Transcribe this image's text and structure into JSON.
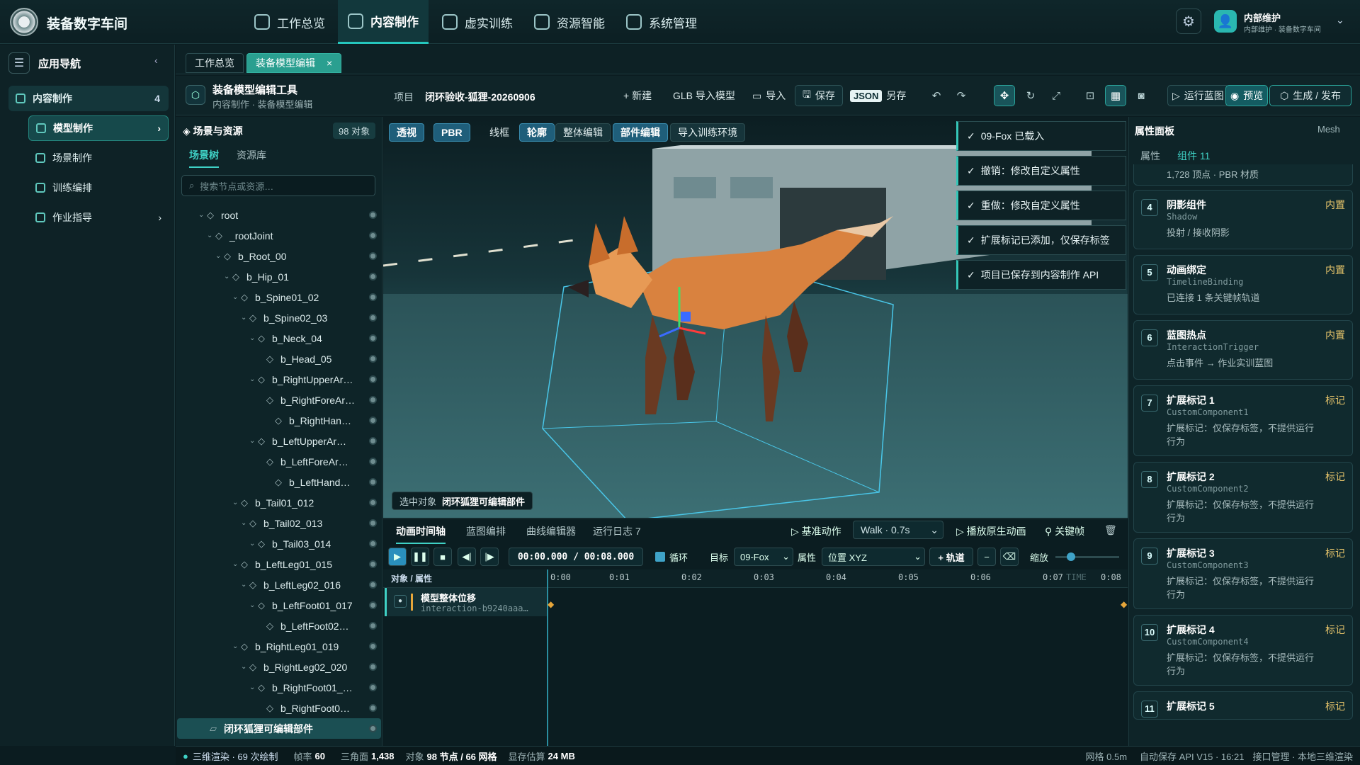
{
  "app": {
    "title": "装备数字车间"
  },
  "topnav": [
    "工作总览",
    "内容制作",
    "虚实训练",
    "资源智能",
    "系统管理"
  ],
  "user": {
    "name": "内部维护",
    "sub": "内部维护 · 装备数字车间"
  },
  "sidebar": {
    "header": "应用导航",
    "section": "内容制作",
    "section_count": "4",
    "items": [
      "模型制作",
      "场景制作",
      "训练编排",
      "作业指导"
    ]
  },
  "file_tabs": [
    "工作总览",
    "装备模型编辑"
  ],
  "toolbar": {
    "title": "装备模型编辑工具",
    "breadcrumb": "内容制作 · 装备模型编辑",
    "project_label": "项目",
    "project_value": "闭环验收-狐狸-20260906",
    "new": "+ 新建",
    "import_model": "GLB 导入模型",
    "import": "导入",
    "save": "保存",
    "json": "JSON",
    "save_as": "另存",
    "run_blueprint": "运行蓝图",
    "preview": "预览",
    "publish": "生成 / 发布"
  },
  "left": {
    "title": "场景与资源",
    "count": "98 对象",
    "tabs": [
      "场景树",
      "资源库"
    ],
    "search_placeholder": "搜索节点或资源…",
    "tree": [
      {
        "n": "root",
        "d": 0
      },
      {
        "n": "_rootJoint",
        "d": 1
      },
      {
        "n": "b_Root_00",
        "d": 2
      },
      {
        "n": "b_Hip_01",
        "d": 3
      },
      {
        "n": "b_Spine01_02",
        "d": 4
      },
      {
        "n": "b_Spine02_03",
        "d": 5
      },
      {
        "n": "b_Neck_04",
        "d": 6
      },
      {
        "n": "b_Head_05",
        "d": 7
      },
      {
        "n": "b_RightUpperAr…",
        "d": 6
      },
      {
        "n": "b_RightForeAr…",
        "d": 7
      },
      {
        "n": "b_RightHan…",
        "d": 8
      },
      {
        "n": "b_LeftUpperAr…",
        "d": 6
      },
      {
        "n": "b_LeftForeAr…",
        "d": 7
      },
      {
        "n": "b_LeftHand…",
        "d": 8
      },
      {
        "n": "b_Tail01_012",
        "d": 4
      },
      {
        "n": "b_Tail02_013",
        "d": 5
      },
      {
        "n": "b_Tail03_014",
        "d": 6
      },
      {
        "n": "b_LeftLeg01_015",
        "d": 4
      },
      {
        "n": "b_LeftLeg02_016",
        "d": 5
      },
      {
        "n": "b_LeftFoot01_017",
        "d": 6
      },
      {
        "n": "b_LeftFoot02…",
        "d": 7
      },
      {
        "n": "b_RightLeg01_019",
        "d": 4
      },
      {
        "n": "b_RightLeg02_020",
        "d": 5
      },
      {
        "n": "b_RightFoot01_…",
        "d": 6
      },
      {
        "n": "b_RightFoot0…",
        "d": 7
      },
      {
        "n": "闭环狐狸可编辑部件",
        "d": 3
      }
    ]
  },
  "viewport": {
    "modes": [
      "透视",
      "PBR",
      "线框",
      "轮廓",
      "整体编辑",
      "部件编辑",
      "导入训练环境"
    ],
    "selected_label": "选中对象",
    "selected_value": "闭环狐狸可编辑部件"
  },
  "toasts": [
    "09-Fox 已载入",
    "撤销：修改自定义属性",
    "重做：修改自定义属性",
    "扩展标记已添加，仅保存标签",
    "项目已保存到内容制作 API"
  ],
  "timeline": {
    "tabs": [
      "动画时间轴",
      "蓝图编排",
      "曲线编辑器",
      "运行日志 7"
    ],
    "base_action": "基准动作",
    "clip": "Walk · 0.7s",
    "play_original": "播放原生动画",
    "keyframe": "关键帧",
    "time": "00:00.000 / 00:08.000",
    "loop": "循环",
    "target_label": "目标",
    "target": "09-Fox",
    "prop_label": "属性",
    "prop": "位置 XYZ",
    "add_track": "+ 轨道",
    "zoom": "缩放",
    "col_header": "对象 / 属性",
    "ticks": [
      "0:00",
      "0:01",
      "0:02",
      "0:03",
      "0:04",
      "0:05",
      "0:06",
      "0:07",
      "0:08"
    ],
    "time_watermark": "TIME",
    "track_name": "模型整体位移",
    "track_id": "interaction-b9240aaa…"
  },
  "right": {
    "title": "属性面板",
    "mesh": "Mesh",
    "tabs": [
      "属性",
      "组件 11"
    ],
    "top_text": "1,728 顶点 · PBR 材质",
    "cards": [
      {
        "num": "4",
        "title": "阴影组件",
        "tag": "内置",
        "sub": "Shadow",
        "desc": "投射 / 接收阴影"
      },
      {
        "num": "5",
        "title": "动画绑定",
        "tag": "内置",
        "sub": "TimelineBinding",
        "desc": "已连接 1 条关键帧轨道"
      },
      {
        "num": "6",
        "title": "蓝图热点",
        "tag": "内置",
        "sub": "InteractionTrigger",
        "desc": "点击事件 → 作业实训蓝图"
      },
      {
        "num": "7",
        "title": "扩展标记 1",
        "tag": "标记",
        "sub": "CustomComponent1",
        "desc": "扩展标记：仅保存标签，不提供运行行为"
      },
      {
        "num": "8",
        "title": "扩展标记 2",
        "tag": "标记",
        "sub": "CustomComponent2",
        "desc": "扩展标记：仅保存标签，不提供运行行为"
      },
      {
        "num": "9",
        "title": "扩展标记 3",
        "tag": "标记",
        "sub": "CustomComponent3",
        "desc": "扩展标记：仅保存标签，不提供运行行为"
      },
      {
        "num": "10",
        "title": "扩展标记 4",
        "tag": "标记",
        "sub": "CustomComponent4",
        "desc": "扩展标记：仅保存标签，不提供运行行为"
      },
      {
        "num": "11",
        "title": "扩展标记 5",
        "tag": "标记",
        "sub": "",
        "desc": ""
      }
    ]
  },
  "status": {
    "render": "三维渲染 · 69 次绘制",
    "fps_label": "帧率",
    "fps": "60",
    "tri_label": "三角面",
    "tri": "1,438",
    "obj_label": "对象",
    "obj": "98 节点 / 66 网格",
    "mem_label": "显存估算",
    "mem": "24 MB",
    "grid": "网格 0.5m",
    "autosave": "自动保存 API V15 · 16:21",
    "api": "接口管理 · 本地三维渲染"
  },
  "colors": {
    "accent": "#3fd1c5",
    "fox": "#d9823f",
    "bbox": "#49c6e8"
  }
}
